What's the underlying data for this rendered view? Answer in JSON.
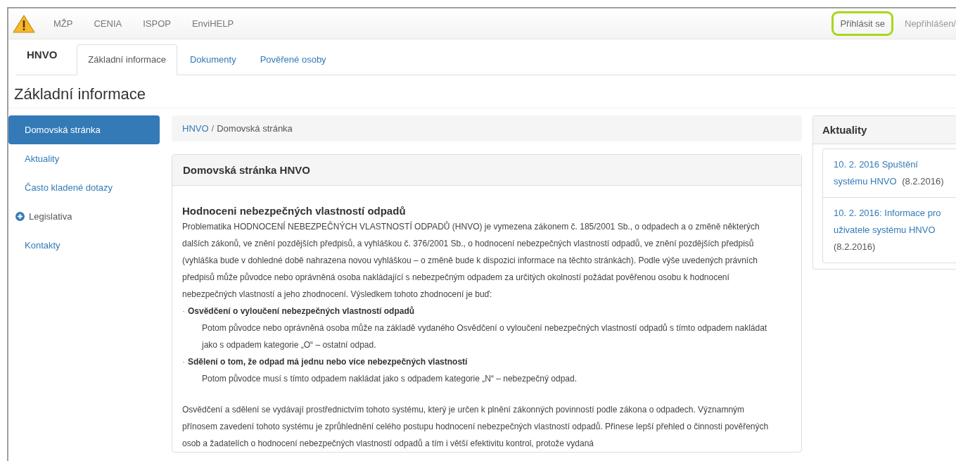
{
  "top_bar": {
    "links": [
      {
        "label": "MŽP"
      },
      {
        "label": "CENIA"
      },
      {
        "label": "ISPOP"
      },
      {
        "label": "EnviHELP"
      }
    ],
    "login": {
      "label": "Přihlásit se",
      "highlighted": true
    },
    "user_status": "Nepřihlášen/"
  },
  "nav": {
    "brand": "HNVO",
    "tabs": [
      {
        "label": "Základní informace",
        "selected": true
      },
      {
        "label": "Dokumenty",
        "selected": false
      },
      {
        "label": "Pověřené osoby",
        "selected": false
      }
    ]
  },
  "page_title": "Základní informace",
  "sidebar": {
    "items": [
      {
        "label": "Domovská stránka",
        "selected": true,
        "kind": "link"
      },
      {
        "label": "Aktuality",
        "selected": false,
        "kind": "link"
      },
      {
        "label": "Často kladené dotazy",
        "selected": false,
        "kind": "link"
      },
      {
        "label": "Legislativa",
        "selected": false,
        "kind": "expandable"
      },
      {
        "label": "Kontakty",
        "selected": false,
        "kind": "link"
      }
    ]
  },
  "breadcrumb": [
    {
      "label": "HNVO"
    },
    {
      "label": "Domovská stránka"
    }
  ],
  "breadcrumb_separator": "/",
  "panel": {
    "title": "Domovská stránka HNVO",
    "heading": "Hodnoceni nebezpečných vlastností odpadů",
    "blocks": [
      {
        "kind": "paragraph",
        "text": "Problematika HODNOCENÍ NEBEZPEČNÝCH VLASTNOSTÍ ODPADŮ (HNVO) je vymezena zákonem č. 185/2001 Sb., o odpadech a o změně některých dalších zákonů, ve znění pozdějších předpisů, a vyhláškou č. 376/2001 Sb., o hodnocení nebezpečných vlastností odpadů, ve znění pozdějších předpisů (vyhláška bude v dohledné době nahrazena novou vyhláškou – o změně bude k dispozici informace na těchto stránkách). Podle výše uvedených právních předpisů může původce nebo oprávněná osoba nakládající s nebezpečným odpadem za určitých okolností požádat pověřenou osobu k hodnocení nebezpečných vlastností a jeho zhodnocení. Výsledkem tohoto zhodnocení je buď:"
      },
      {
        "kind": "bullet",
        "marker": "·",
        "text": "Osvědčení o vyloučení nebezpečných vlastností odpadů"
      },
      {
        "kind": "indented",
        "text": "Potom původce nebo oprávněná osoba může na základě vydaného Osvědčení o vyloučení nebezpečných vlastností odpadů s tímto odpadem nakládat jako s odpadem kategorie „O“ – ostatní odpad."
      },
      {
        "kind": "bullet",
        "marker": "·",
        "text": "Sdělení o tom, že odpad má jednu nebo více nebezpečných vlastností"
      },
      {
        "kind": "indented",
        "text": "Potom původce musí s tímto odpadem nakládat jako s odpadem kategorie „N“ – nebezpečný odpad."
      },
      {
        "kind": "spaced",
        "text": "Osvědčení a sdělení se vydávají prostřednictvím tohoto systému, který je určen k plnění zákonných povinností podle zákona o odpadech. Významným přínosem zavedení tohoto systému je zprůhlednění celého postupu hodnocení nebezpečných vlastností odpadů. Přinese lepší přehled o činnosti pověřených osob a žadatelích o hodnocení nebezpečných vlastností odpadů a tím i větší efektivitu kontrol, protože vydaná"
      }
    ]
  },
  "news": {
    "title": "Aktuality",
    "items": [
      {
        "link": "10. 2. 2016 Spuštění systému HNVO",
        "date": "(8.2.2016)"
      },
      {
        "link": "10. 2. 2016: Informace pro uživatele systému HNVO",
        "date": "(8.2.2016)"
      }
    ]
  }
}
